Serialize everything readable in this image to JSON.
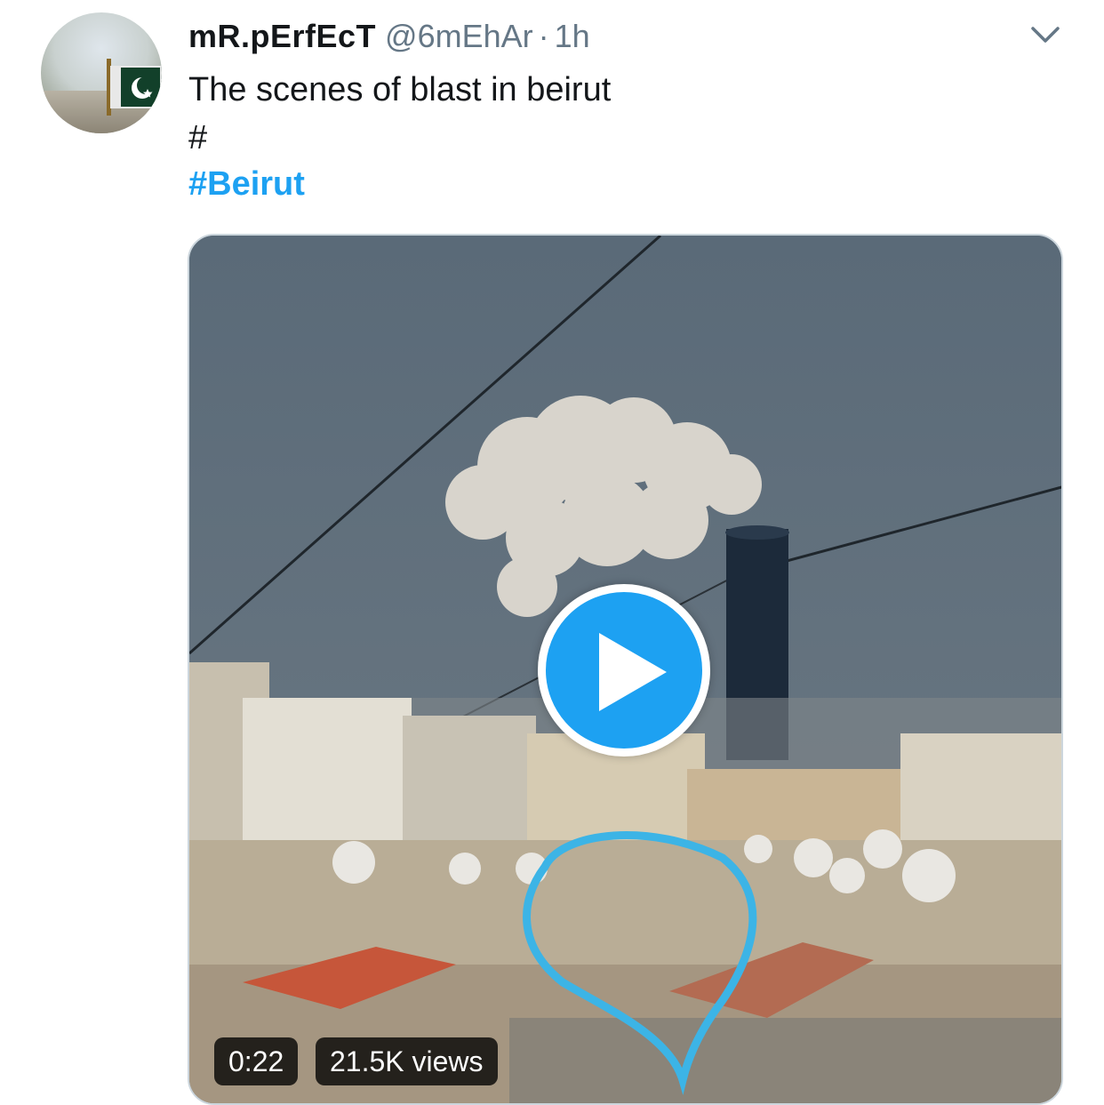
{
  "tweet": {
    "display_name": "mR.pErfEcT",
    "handle": "@6mEhAr",
    "separator": "·",
    "time": "1h",
    "text_line1": "The scenes of blast in beirut",
    "text_line2": "#",
    "hashtag": "#Beirut"
  },
  "icons": {
    "menu": "chevron-down-icon",
    "play": "play-icon"
  },
  "media": {
    "type": "video",
    "duration": "0:22",
    "views": "21.5K views"
  },
  "colors": {
    "link": "#1da1f2",
    "play_button": "#1da1f2",
    "secondary_text": "#657786",
    "annotation_circle": "#3cb4e6"
  }
}
